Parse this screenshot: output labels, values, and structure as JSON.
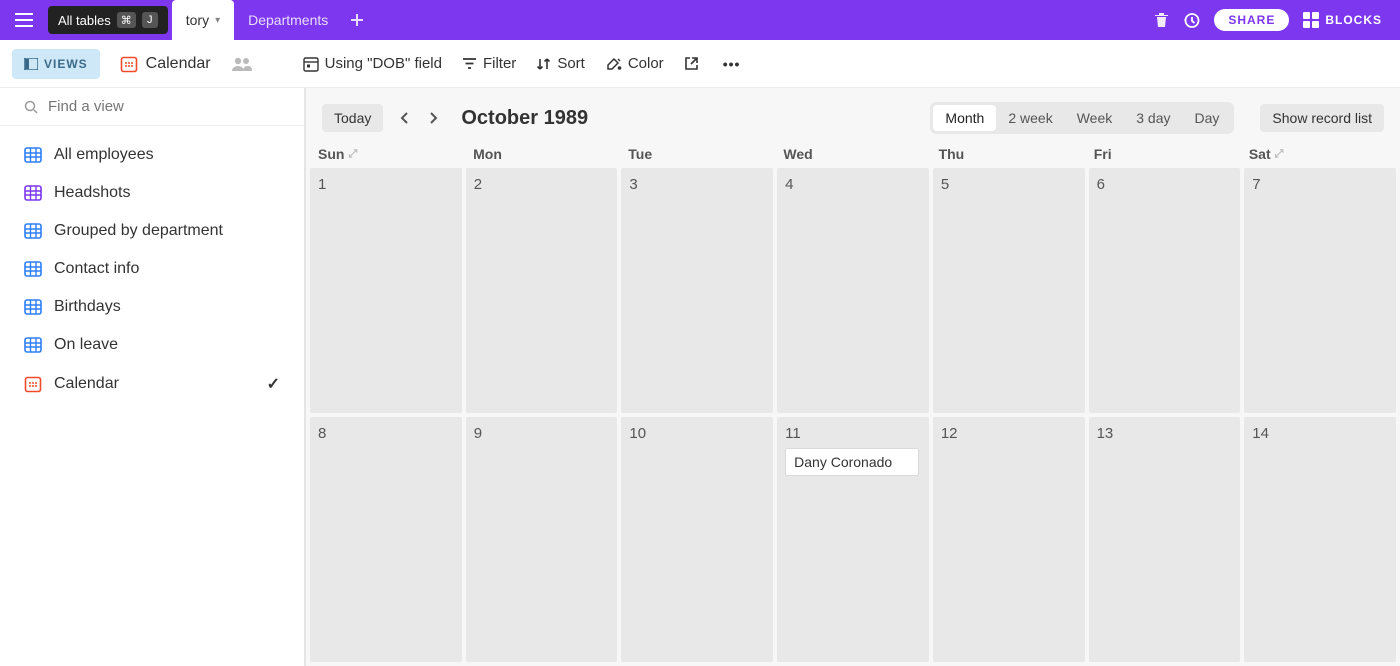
{
  "topbar": {
    "tooltip_label": "All tables",
    "key1": "⌘",
    "key2": "J",
    "tab_active": "tory",
    "tab_inactive": "Departments",
    "share_label": "SHARE",
    "blocks_label": "BLOCKS"
  },
  "toolbar": {
    "views_label": "VIEWS",
    "viewname": "Calendar",
    "dob_label": "Using \"DOB\" field",
    "filter_label": "Filter",
    "sort_label": "Sort",
    "color_label": "Color"
  },
  "sidebar": {
    "find_placeholder": "Find a view",
    "items": [
      {
        "label": "All employees",
        "type": "grid",
        "active": false
      },
      {
        "label": "Headshots",
        "type": "gallery",
        "active": false
      },
      {
        "label": "Grouped by department",
        "type": "grid",
        "active": false
      },
      {
        "label": "Contact info",
        "type": "grid",
        "active": false
      },
      {
        "label": "Birthdays",
        "type": "grid",
        "active": false
      },
      {
        "label": "On leave",
        "type": "grid",
        "active": false
      },
      {
        "label": "Calendar",
        "type": "calendar",
        "active": true
      }
    ]
  },
  "calendar": {
    "today_label": "Today",
    "month_label": "October 1989",
    "segments": [
      "Month",
      "2 week",
      "Week",
      "3 day",
      "Day"
    ],
    "active_segment": "Month",
    "show_record_label": "Show record list",
    "day_headers": [
      "Sun",
      "Mon",
      "Tue",
      "Wed",
      "Thu",
      "Fri",
      "Sat"
    ],
    "cells": [
      {
        "n": "1"
      },
      {
        "n": "2"
      },
      {
        "n": "3"
      },
      {
        "n": "4"
      },
      {
        "n": "5"
      },
      {
        "n": "6"
      },
      {
        "n": "7"
      },
      {
        "n": "8"
      },
      {
        "n": "9"
      },
      {
        "n": "10"
      },
      {
        "n": "11",
        "event": "Dany Coronado"
      },
      {
        "n": "12"
      },
      {
        "n": "13"
      },
      {
        "n": "14"
      }
    ]
  }
}
